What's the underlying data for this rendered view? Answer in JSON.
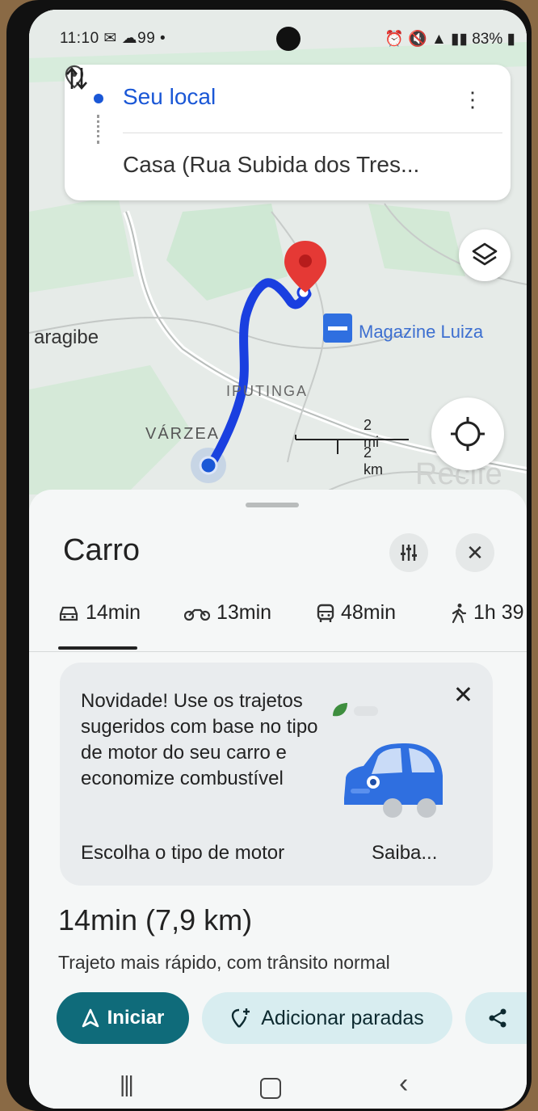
{
  "status_bar": {
    "time": "11:10",
    "notif_count": "99",
    "battery": "83%"
  },
  "route": {
    "origin": "Seu local",
    "destination": "Casa (Rua Subida dos Tres..."
  },
  "map": {
    "labels": {
      "place1": "aragibe",
      "place2": "VÁRZEA",
      "place3": "IPUTINGA",
      "poi": "Magazine Luiza",
      "city": "Recife"
    },
    "scale": {
      "miles": "2 mi",
      "km": "2 km"
    },
    "route_color": "#1a3fe0",
    "pin_color": "#e53935"
  },
  "sheet": {
    "title": "Carro",
    "tabs": [
      {
        "icon": "car-icon",
        "label": "14min"
      },
      {
        "icon": "motorcycle-icon",
        "label": "13min"
      },
      {
        "icon": "transit-icon",
        "label": "48min"
      },
      {
        "icon": "walk-icon",
        "label": "1h 39"
      }
    ],
    "promo": {
      "text": "Novidade! Use os trajetos sugeridos com base no tipo de motor do seu carro e economize combustível",
      "action_primary": "Escolha o tipo de motor",
      "action_secondary": "Saiba..."
    },
    "eta": "14min (7,9 km)",
    "eta_detail": "Trajeto mais rápido, com trânsito normal",
    "start_label": "Iniciar",
    "add_stops_label": "Adicionar paradas"
  },
  "colors": {
    "accent": "#0f6b7a",
    "accent_light": "#d8edf0",
    "origin_blue": "#1a57d6"
  }
}
